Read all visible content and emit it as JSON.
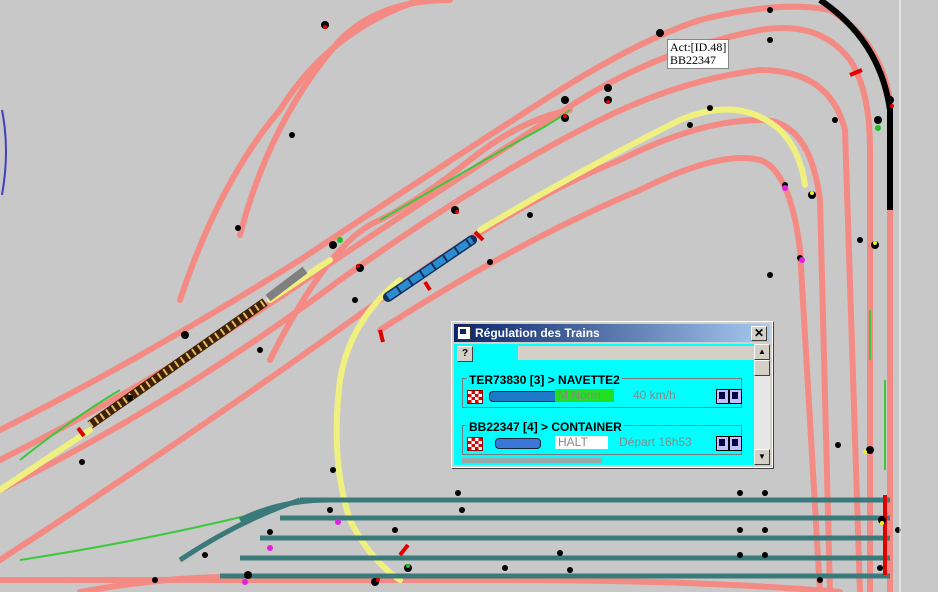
{
  "colors": {
    "background": "#c8c8c8",
    "track": "#f48a84",
    "track_active": "#f0f080",
    "track_blocked": "#000000",
    "yard_track": "#3a7a7a",
    "window_client": "#00ffff",
    "title_bar": "#0a246a"
  },
  "tooltip": {
    "line1": "Act:[ID.48]",
    "line2": "BB22347"
  },
  "dialog": {
    "title": "Régulation des Trains",
    "help_label": "?",
    "close_label": "✕",
    "trains": [
      {
        "header": "TER73830 [3] > NAVETTE2",
        "mode": "M.Norm",
        "speed": "40 km/h",
        "mode_color": "#20e020",
        "loco_color": "#1e78c8"
      },
      {
        "header": "BB22347 [4] > CONTAINER",
        "mode": "HALT",
        "status": "Départ 16h53",
        "mode_color": "#ffffff",
        "loco_color": "#3a78d8"
      }
    ],
    "partial_header": "TER73830 [3] > NAVETTE2"
  },
  "icons": [
    "window-icon",
    "close-icon",
    "help-icon",
    "checkered-flag-icon",
    "locomotive-icon",
    "info-icon",
    "schedule-icon",
    "signal-icon",
    "scroll-up-icon",
    "scroll-down-icon"
  ]
}
